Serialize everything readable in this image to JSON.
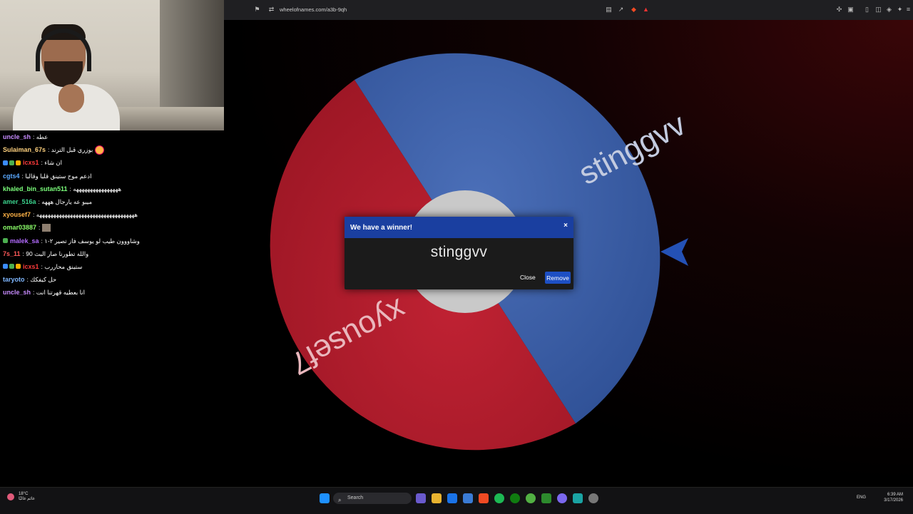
{
  "browser": {
    "url": "wheelofnames.com/a3b-9qh"
  },
  "wheel": {
    "entries": [
      {
        "name": "stinggvv",
        "color": "#3a5ea6"
      },
      {
        "name": "xyousef7",
        "color": "#b01c2a"
      }
    ],
    "hub_color": "#c9c9c9",
    "pointer_color": "#2451b5"
  },
  "dialog": {
    "title": "We have a winner!",
    "close_glyph": "×",
    "winner": "stinggvv",
    "close_label": "Close",
    "remove_label": "Remove",
    "header_color": "#1a3fa0"
  },
  "chat": {
    "messages": [
      {
        "user": "uncle_sh",
        "color": "#c88cff",
        "text": ": عطه",
        "badges": []
      },
      {
        "user": "Sulaiman_67s",
        "color": "#ffd27f",
        "text": ": بوزري قبل الترند",
        "badges": [],
        "emote": true
      },
      {
        "user": "icxs1",
        "color": "#ff3b3b",
        "text": ": ان شاء",
        "badges": [
          "#3b8cff",
          "#4caf50",
          "#ffb000"
        ]
      },
      {
        "user": "cgts4",
        "color": "#5aa9ff",
        "text": ": ادعم موح ستينق قلبا وقالبا",
        "badges": []
      },
      {
        "user": "khaled_bin_sutan511",
        "color": "#7cff7c",
        "text": ": ههههههههههههههههه",
        "badges": []
      },
      {
        "user": "amer_516a",
        "color": "#3ad18c",
        "text": ": ميبو عه يارجال هههه",
        "badges": []
      },
      {
        "user": "xyousef7",
        "color": "#ffb347",
        "text": ": هههههههههههههههههههههههههههههههههههه",
        "badges": []
      },
      {
        "user": "omar03887",
        "color": "#8cff6a",
        "text": ":",
        "badges": [],
        "emote_img": true
      },
      {
        "user": "malek_sa",
        "color": "#b36bff",
        "text": ": وشاووون طيب لو يوسف فاز تصير ٢-١",
        "badges": [
          "#4caf50"
        ]
      },
      {
        "user": "7s_11",
        "color": "#ff5a5a",
        "text": ": والله تطورنا صار البث 90",
        "badges": []
      },
      {
        "user": "icxs1",
        "color": "#ff3b3b",
        "text": ": ستينق محاررب",
        "badges": [
          "#3b8cff",
          "#4caf50",
          "#ffb000"
        ]
      },
      {
        "user": "taryoto",
        "color": "#7fb7ff",
        "text": ": حل كيفكك",
        "badges": []
      },
      {
        "user": "uncle_sh",
        "color": "#c88cff",
        "text": ": انا بعطيه قهرتنا انت",
        "badges": []
      }
    ]
  },
  "taskbar": {
    "weather_temp": "18°C",
    "weather_desc": "غائم غالبًا",
    "search_label": "Search",
    "language": "ENG",
    "time": "6:39 AM",
    "date": "3/17/2026"
  }
}
